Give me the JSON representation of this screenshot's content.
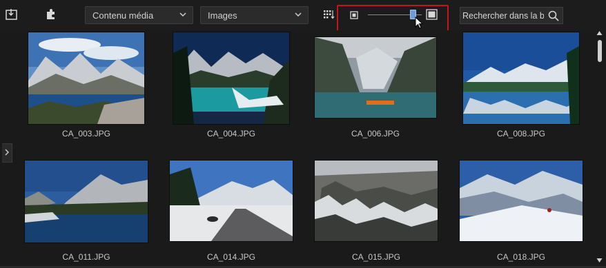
{
  "toolbar": {
    "import_icon": "import-folder-icon",
    "plugin_icon": "puzzle-plugin-icon",
    "content_filter": {
      "selected": "Contenu média"
    },
    "type_filter": {
      "selected": "Images"
    },
    "sort_icon": "sort-grid-icon",
    "thumbnail_size_small_icon": "small-thumbnail-icon",
    "thumbnail_size_large_icon": "large-thumbnail-icon",
    "thumbnail_size_level": 0.88,
    "search": {
      "value": "Rechercher dans la b"
    }
  },
  "media": [
    {
      "filename": "CA_003.JPG"
    },
    {
      "filename": "CA_004.JPG"
    },
    {
      "filename": "CA_006.JPG"
    },
    {
      "filename": "CA_008.JPG"
    },
    {
      "filename": "CA_011.JPG"
    },
    {
      "filename": "CA_014.JPG"
    },
    {
      "filename": "CA_015.JPG"
    },
    {
      "filename": "CA_018.JPG"
    }
  ],
  "colors": {
    "background": "#1a1a1a",
    "highlight": "#c8141d",
    "slider_thumb": "#6f9bd8"
  }
}
